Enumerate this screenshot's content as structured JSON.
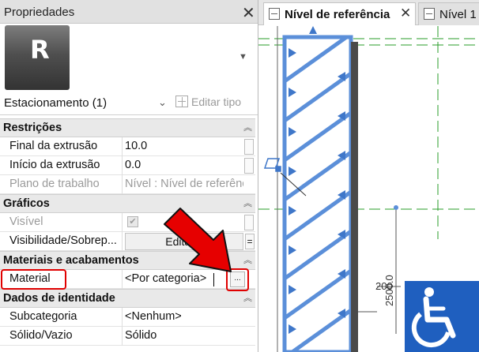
{
  "panel": {
    "title": "Propriedades",
    "close_glyph": "✕",
    "logo_letter": "R",
    "selector": {
      "value": "Estacionamento (1)",
      "edit_type_label": "Editar tipo"
    }
  },
  "groups": {
    "restricoes": {
      "title": "Restrições"
    },
    "graficos": {
      "title": "Gráficos"
    },
    "materiais": {
      "title": "Materiais e acabamentos"
    },
    "identidade": {
      "title": "Dados de identidade"
    }
  },
  "params": {
    "final_extrusao": {
      "label": "Final da extrusão",
      "value": "10.0"
    },
    "inicio_extrusao": {
      "label": "Início da extrusão",
      "value": "0.0"
    },
    "plano_trabalho": {
      "label": "Plano de trabalho",
      "value": "Nível : Nível de referência"
    },
    "visivel": {
      "label": "Visível",
      "checked": true
    },
    "visibilidade": {
      "label": "Visibilidade/Sobrep...",
      "button": "Editar..."
    },
    "material": {
      "label": "Material",
      "value": "<Por categoria>",
      "browse": "..."
    },
    "subcategoria": {
      "label": "Subcategoria",
      "value": "<Nenhum>"
    },
    "solido_vazio": {
      "label": "Sólido/Vazio",
      "value": "Sólido"
    }
  },
  "view": {
    "tabs": [
      {
        "label": "Nível de referência",
        "active": true
      },
      {
        "label": "Nível 1",
        "active": false
      }
    ],
    "dimensions": {
      "small": "200",
      "vertical": "2500.0"
    }
  },
  "colors": {
    "highlight": "#e00000",
    "hatch_blue": "#5b8fd9",
    "sign_blue": "#1f5fbf"
  },
  "icons": [
    "close-icon",
    "revit-logo",
    "edit-type-icon",
    "collapse-chevron-icon",
    "browse-icon",
    "view-tab-icon",
    "accessibility-icon"
  ]
}
